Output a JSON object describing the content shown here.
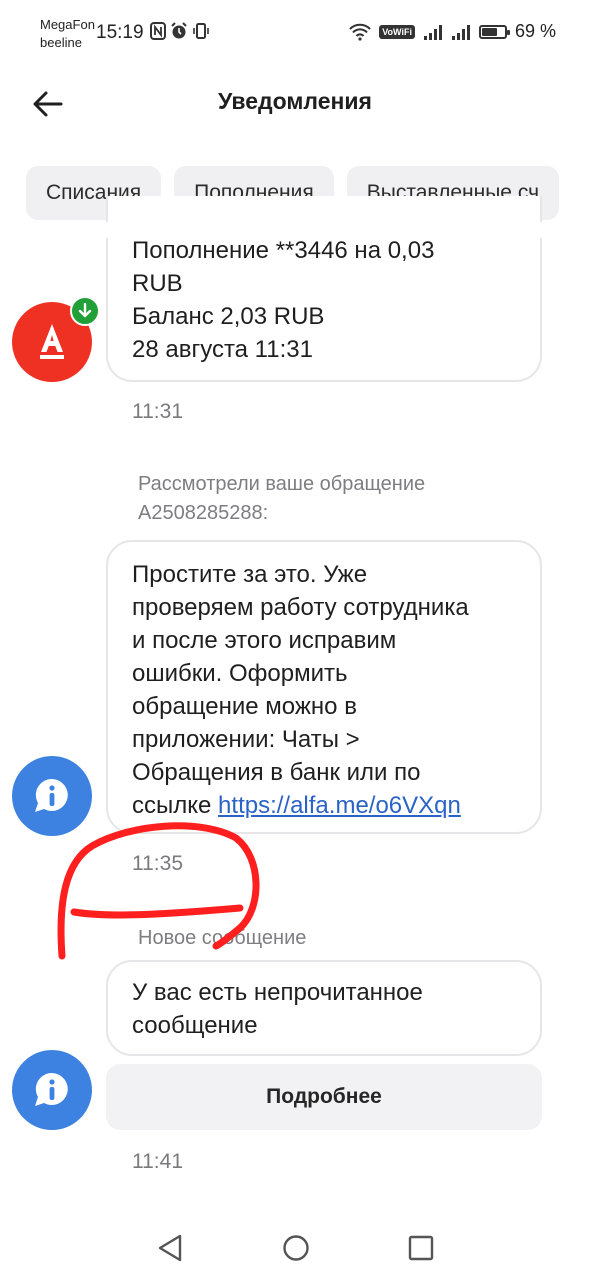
{
  "status_bar": {
    "carrier_1": "MegaFon",
    "carrier_2": "beeline",
    "time": "15:19",
    "vowifi": "VoWiFi",
    "battery_percent": "69 %",
    "battery_level": 0.69
  },
  "header": {
    "title": "Уведомления"
  },
  "filters": [
    {
      "label": "Списания"
    },
    {
      "label": "Пополнения"
    },
    {
      "label": "Выставленные сч"
    }
  ],
  "messages": [
    {
      "lines": [
        "Пополнение **3446 на 0,03",
        "RUB",
        "Баланс 2,03 RUB",
        "28 августа 11:31"
      ],
      "time": "11:31"
    },
    {
      "caption_lines": [
        "Рассмотрели ваше обращение",
        "А2508285288:"
      ],
      "lines": [
        "Простите за это. Уже",
        "проверяем работу сотрудника",
        "и после этого исправим",
        "ошибки. Оформить",
        "обращение можно в",
        "приложении: Чаты >",
        "Обращения в банк или по"
      ],
      "last_line_prefix": "ссылке ",
      "link": "https://alfa.me/o6VXqn",
      "time": "11:35"
    },
    {
      "caption": "Новое сообщение",
      "lines": [
        "У вас есть непрочитанное",
        "сообщение"
      ],
      "button_label": "Подробнее",
      "time": "11:41"
    }
  ],
  "colors": {
    "alfa_red": "#ef3124",
    "info_blue": "#3d82e0",
    "badge_green": "#21a038",
    "annotation_red": "#ff1f1f"
  }
}
